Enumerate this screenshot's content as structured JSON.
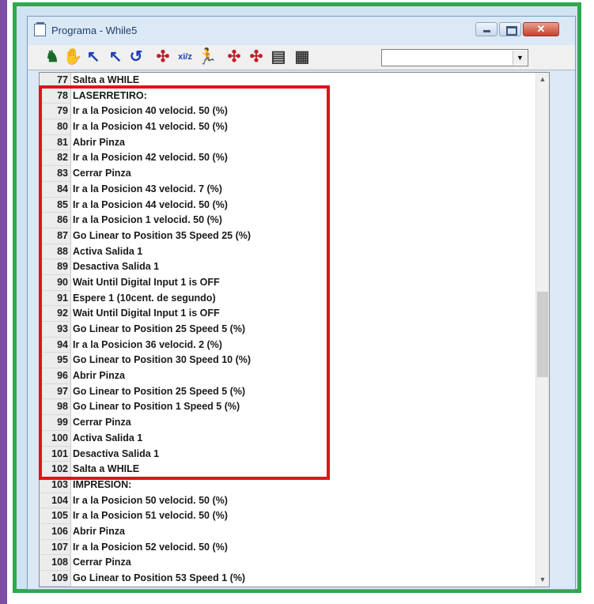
{
  "window": {
    "title": "Programa - While5"
  },
  "toolbar": {
    "tools": [
      {
        "icon": "robot-move-icon",
        "glyph": "♞",
        "color": "#1a6b2a"
      },
      {
        "icon": "gripper-icon",
        "glyph": "✋",
        "color": "#8b1a1a"
      },
      {
        "icon": "arrow-up-right-icon",
        "glyph": "↖",
        "color": "#1d3fb8"
      },
      {
        "icon": "arrow-up-left-icon",
        "glyph": "↖",
        "color": "#1d3fb8"
      },
      {
        "icon": "undo-icon",
        "glyph": "↺",
        "color": "#1d3fb8"
      },
      {
        "icon": "io-icon",
        "glyph": "✣",
        "color": "#c0202a"
      },
      {
        "icon": "xiyi-icon",
        "glyph": "xi/z",
        "color": "#1d3fb8"
      },
      {
        "icon": "run-figure-icon",
        "glyph": "🏃",
        "color": "#1a1a1a"
      },
      {
        "icon": "connect-icon",
        "glyph": "✣",
        "color": "#c0202a"
      },
      {
        "icon": "output-icon",
        "glyph": "✣",
        "color": "#c0202a"
      },
      {
        "icon": "chart-icon",
        "glyph": "▤",
        "color": "#3a3a3a"
      },
      {
        "icon": "table-icon",
        "glyph": "▦",
        "color": "#3a3a3a"
      }
    ],
    "combo_value": ""
  },
  "rows": [
    {
      "n": "77",
      "t": "Salta a WHILE"
    },
    {
      "n": "78",
      "t": "LASERRETIRO:"
    },
    {
      "n": "79",
      "t": "Ir a la Posicion 40 velocid. 50 (%)"
    },
    {
      "n": "80",
      "t": "Ir a la Posicion 41 velocid. 50 (%)"
    },
    {
      "n": "81",
      "t": "Abrir Pinza"
    },
    {
      "n": "82",
      "t": "Ir a la Posicion 42 velocid. 50 (%)"
    },
    {
      "n": "83",
      "t": "Cerrar Pinza"
    },
    {
      "n": "84",
      "t": "Ir a la Posicion 43 velocid. 7 (%)"
    },
    {
      "n": "85",
      "t": "Ir a la Posicion 44 velocid. 50 (%)"
    },
    {
      "n": "86",
      "t": "Ir a la Posicion 1 velocid. 50 (%)"
    },
    {
      "n": "87",
      "t": "Go Linear to Position 35 Speed 25 (%)"
    },
    {
      "n": "88",
      "t": "Activa Salida 1"
    },
    {
      "n": "89",
      "t": "Desactiva Salida 1"
    },
    {
      "n": "90",
      "t": "Wait Until Digital Input 1 is OFF"
    },
    {
      "n": "91",
      "t": "Espere 1 (10cent. de segundo)"
    },
    {
      "n": "92",
      "t": "Wait Until Digital Input 1 is OFF"
    },
    {
      "n": "93",
      "t": "Go Linear to Position 25 Speed 5 (%)"
    },
    {
      "n": "94",
      "t": "Ir a la Posicion 36 velocid. 2 (%)"
    },
    {
      "n": "95",
      "t": "Go Linear to Position 30 Speed 10 (%)"
    },
    {
      "n": "96",
      "t": "Abrir Pinza"
    },
    {
      "n": "97",
      "t": "Go Linear to Position 25 Speed 5 (%)"
    },
    {
      "n": "98",
      "t": "Go Linear to Position 1 Speed 5 (%)"
    },
    {
      "n": "99",
      "t": "Cerrar Pinza"
    },
    {
      "n": "100",
      "t": "Activa Salida 1"
    },
    {
      "n": "101",
      "t": "Desactiva Salida 1"
    },
    {
      "n": "102",
      "t": "Salta a WHILE"
    },
    {
      "n": "103",
      "t": "IMPRESION:"
    },
    {
      "n": "104",
      "t": "Ir a la Posicion 50 velocid. 50 (%)"
    },
    {
      "n": "105",
      "t": "Ir a la Posicion 51 velocid. 50 (%)"
    },
    {
      "n": "106",
      "t": "Abrir Pinza"
    },
    {
      "n": "107",
      "t": "Ir a la Posicion 52 velocid. 50 (%)"
    },
    {
      "n": "108",
      "t": "Cerrar Pinza"
    },
    {
      "n": "109",
      "t": "Go Linear to Position 53 Speed 1 (%)"
    }
  ],
  "colors": {
    "highlight": "#e1131a",
    "frame": "#2fa84f",
    "accent_bar": "#7b4fa6"
  }
}
